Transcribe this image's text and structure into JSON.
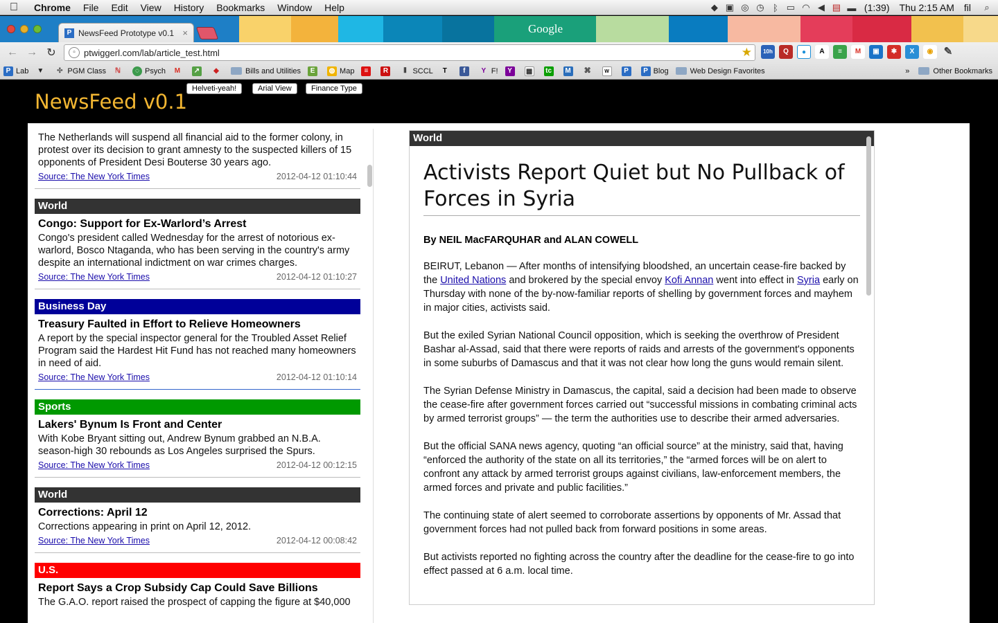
{
  "menubar": {
    "app": "Chrome",
    "items": [
      "File",
      "Edit",
      "View",
      "History",
      "Bookmarks",
      "Window",
      "Help"
    ],
    "battery": "(1:39)",
    "clock": "Thu 2:15 AM",
    "user": "fil"
  },
  "tab": {
    "title": "NewsFeed Prototype v0.1",
    "close": "×"
  },
  "doodle": {
    "text": "Google"
  },
  "omnibox": {
    "url": "ptwiggerl.com/lab/article_test.html"
  },
  "extensions": [
    "10h",
    "Q",
    "A",
    "M",
    "R",
    "X"
  ],
  "bookmarks": {
    "items": [
      "Lab",
      "PGM Class",
      "Psych",
      "Bills and Utilities",
      "Map",
      "SCCL",
      "F!",
      "Blog",
      "Web Design Favorites"
    ],
    "other": "Other Bookmarks",
    "chevron": "»"
  },
  "page": {
    "brand": "NewsFeed v0.1",
    "buttons": [
      "Helveti-yeah!",
      "Arial View",
      "Finance Type"
    ]
  },
  "feed": {
    "top": {
      "summary": "The Netherlands will suspend all financial aid to the former colony, in protest over its decision to grant amnesty to the suspected killers of 15 opponents of President Desi Bouterse 30 years ago.",
      "source": "Source: The New York Times",
      "time": "2012-04-12 01:10:44"
    },
    "items": [
      {
        "category": "World",
        "headline": "Congo: Support for Ex-Warlord’s Arrest",
        "summary": "Congo's president called Wednesday for the arrest of notorious ex-warlord, Bosco Ntaganda, who has been serving in the country's army despite an international indictment on war crimes charges.",
        "source": "Source: The New York Times",
        "time": "2012-04-12 01:10:27"
      },
      {
        "category": "Business Day",
        "headline": "Treasury Faulted in Effort to Relieve Homeowners",
        "summary": "A report by the special inspector general for the Troubled Asset Relief Program said the Hardest Hit Fund has not reached many homeowners in need of aid.",
        "source": "Source: The New York Times",
        "time": "2012-04-12 01:10:14"
      },
      {
        "category": "Sports",
        "headline": "Lakers' Bynum Is Front and Center",
        "summary": "With Kobe Bryant sitting out, Andrew Bynum grabbed an N.B.A. season-high 30 rebounds as Los Angeles surprised the Spurs.",
        "source": "Source: The New York Times",
        "time": "2012-04-12 00:12:15"
      },
      {
        "category": "World",
        "headline": "Corrections: April 12",
        "summary": "Corrections appearing in print on April 12, 2012.",
        "source": "Source: The New York Times",
        "time": "2012-04-12 00:08:42"
      },
      {
        "category": "U.S.",
        "headline": "Report Says a Crop Subsidy Cap Could Save Billions",
        "summary": "The G.A.O. report raised the prospect of capping the figure at $40,000"
      }
    ]
  },
  "article": {
    "category": "World",
    "title": "Activists Report Quiet but No Pullback of Forces in Syria",
    "byline": "By NEIL MacFARQUHAR and ALAN COWELL",
    "p1": {
      "a": "BEIRUT, Lebanon — After months of intensifying bloodshed, an uncertain cease-fire backed by the ",
      "link1": "United Nations",
      "b": " and brokered by the special envoy ",
      "link2": "Kofi Annan",
      "c": " went into effect in ",
      "link3": "Syria",
      "d": " early on Thursday with none of the by-now-familiar reports of shelling by government forces and mayhem in major cities, activists said."
    },
    "p2": "But the exiled Syrian National Council opposition, which is seeking the overthrow of President Bashar al-Assad, said that there were reports of raids and arrests of the government's opponents in some suburbs of Damascus and that it was not clear how long the guns would remain silent.",
    "p3": "The Syrian Defense Ministry in Damascus, the capital, said a decision had been made to observe the cease-fire after government forces carried out “successful missions in combating criminal acts by armed terrorist groups” — the term the authorities use to describe their armed adversaries.",
    "p4": "But the official SANA news agency, quoting “an official source” at the ministry, said that, having “enforced the authority of the state on all its territories,” the “armed forces will be on alert to confront any attack by armed terrorist groups against civilians, law-enforcement members, the armed forces and private and public facilities.”",
    "p5": "The continuing state of alert seemed to corroborate assertions by opponents of Mr. Assad that government forces had not pulled back from forward positions in some areas.",
    "p6": "But activists reported no fighting across the country after the deadline for the cease-fire to go into effect passed at 6 a.m. local time."
  }
}
